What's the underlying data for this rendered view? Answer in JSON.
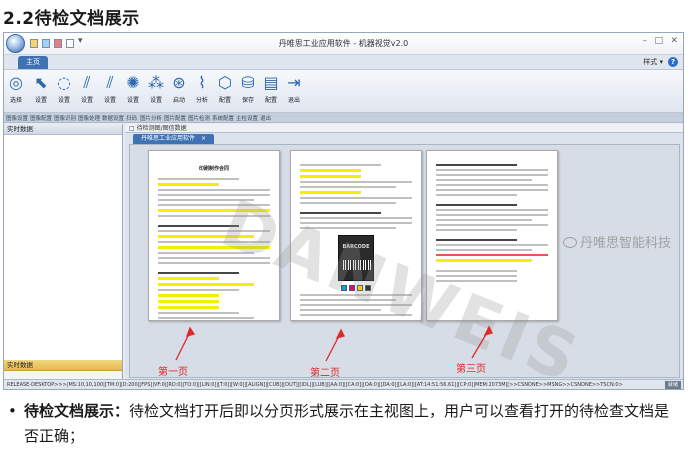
{
  "heading": "2.2待检文档展示",
  "app": {
    "title": "丹唯思工业应用软件 - 机器视觉v2.0",
    "ribbon_tab": "主页",
    "style_menu": "样式 ▾",
    "help": "?",
    "toolbar": [
      {
        "label": "选择",
        "icon": "select-icon",
        "glyph": "◎"
      },
      {
        "label": "设置",
        "icon": "cursor-icon",
        "glyph": "⬉"
      },
      {
        "label": "设置",
        "icon": "lasso-icon",
        "glyph": "◌"
      },
      {
        "label": "设置",
        "icon": "lines-icon",
        "glyph": "⫽"
      },
      {
        "label": "设置",
        "icon": "lines-icon",
        "glyph": "⫽"
      },
      {
        "label": "设置",
        "icon": "palette-icon",
        "glyph": "✺"
      },
      {
        "label": "设置",
        "icon": "network-icon",
        "glyph": "⁂"
      },
      {
        "label": "启动",
        "icon": "scan-icon",
        "glyph": "⊛"
      },
      {
        "label": "分析",
        "icon": "chart-icon",
        "glyph": "⌇"
      },
      {
        "label": "配置",
        "icon": "cube-icon",
        "glyph": "⬡"
      },
      {
        "label": "保存",
        "icon": "database-icon",
        "glyph": "⛁"
      },
      {
        "label": "配置",
        "icon": "config-icon",
        "glyph": "▤"
      },
      {
        "label": "退出",
        "icon": "exit-icon",
        "glyph": "⇥"
      }
    ],
    "group_labels": [
      "图像设置",
      "图像配置",
      "图像识别",
      "图像处理",
      "数据设置",
      "扫码",
      "图片分析",
      "图片配置",
      "图片检测",
      "系统配置",
      "主检设置",
      "退出"
    ],
    "left_panel": {
      "header": "实时数据",
      "footer_header": "实时数据"
    },
    "main_caption": "□ 待检测图/图信数据",
    "doc_tab": "丹唯思工业应用软件",
    "doc_tab_close": "×",
    "status_text": "RELEASE-DESKTOP>>>|MS:10,10,100|[TM:0]|D:200|[FPS]|VF:0|[RD:0]|TO:0]|[LIN:0]|[T:0]|[W:0]|[ALIGN]|[CUB]|[OUT]|[IDL]|[LUB]|[AA:0]|[CA:0]|[OA:0]|[DA:0]|[LA:0]|[AT:14:51:56.61]|[CP:0]|MEM:2073M|[>>CSNONE>>MSNG>>CSNONE>>TSCN:0>",
    "status_right": "就绪"
  },
  "pages": [
    {
      "title": "印刷制作合同",
      "caption": "第一页"
    },
    {
      "title": "",
      "caption": "第二页"
    },
    {
      "title": "",
      "caption": "第三页"
    }
  ],
  "page2_product": "BARCODE",
  "watermark": "DANWEIS",
  "brand_watermark": "丹唯思智能科技",
  "bullet": {
    "strong": "待检文档展示：",
    "text": "待检文档打开后即以分页形式展示在主视图上，用户可以查看打开的待检查文档是否正确；"
  },
  "colors": {
    "highlight": "#f3f000",
    "annotation_red": "#e02828",
    "ribbon_blue": "#3e72b3"
  }
}
